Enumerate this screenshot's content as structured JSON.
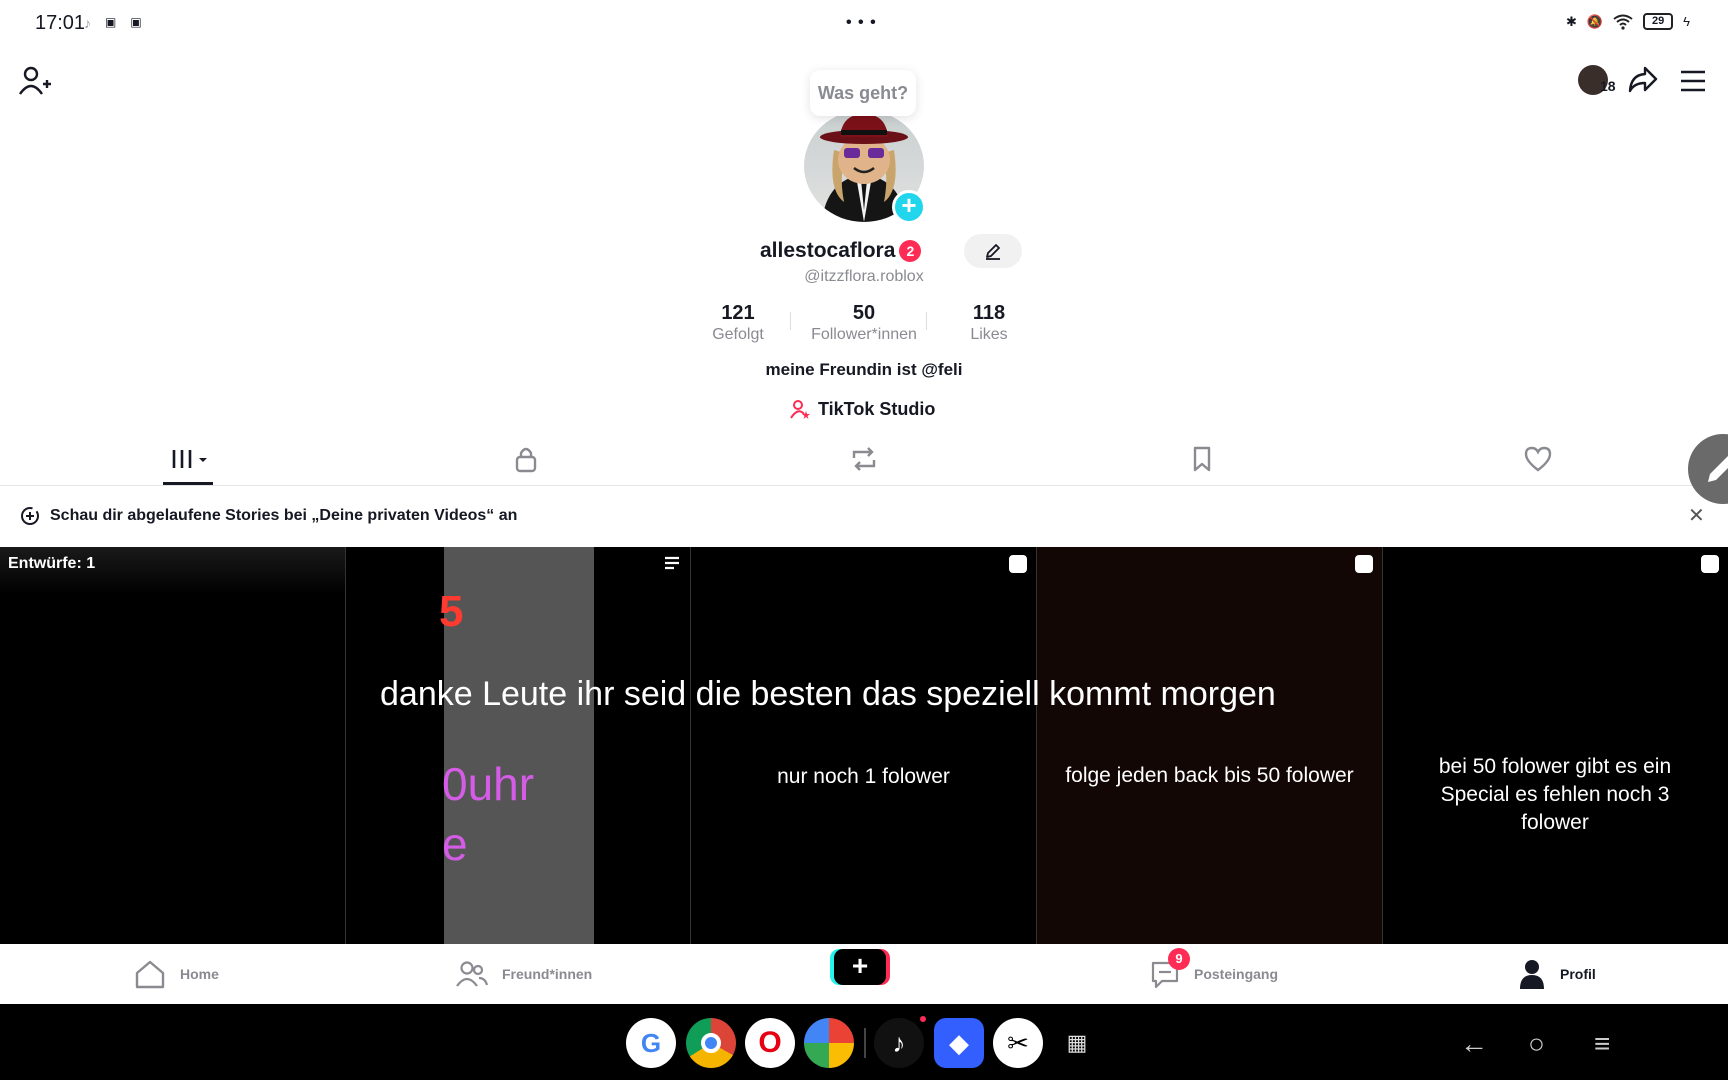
{
  "status_bar": {
    "time": "17:01",
    "battery": "29",
    "more": "• • •"
  },
  "header": {
    "story_bubble": "Was geht?",
    "notification_count": "18"
  },
  "profile": {
    "display_name": "allestocaflora",
    "name_badge": "2",
    "handle": "@itzzflora.roblox",
    "stats": [
      {
        "value": "121",
        "label": "Gefolgt"
      },
      {
        "value": "50",
        "label": "Follower*innen"
      },
      {
        "value": "118",
        "label": "Likes"
      }
    ],
    "bio": "meine Freundin ist @feli",
    "studio_link": "TikTok Studio"
  },
  "banner": {
    "text": "Schau dir abgelaufene Stories bei „Deine privaten Videos“ an"
  },
  "grid": {
    "drafts_label": "Entwürfe: 1",
    "overlay_caption": "danke Leute ihr seid die besten das speziell kommt morgen",
    "cells": [
      {
        "text": ""
      },
      {
        "text": "0uhr",
        "subtext": "e"
      },
      {
        "text": "nur noch 1 folower"
      },
      {
        "text": "folge jeden back bis 50 folower"
      },
      {
        "text": "bei 50 folower gibt es ein Special es fehlen noch 3 folower"
      }
    ]
  },
  "nav": {
    "items": [
      {
        "label": "Home"
      },
      {
        "label": "Freund*innen"
      },
      {
        "label": "Posteingang",
        "badge": "9"
      },
      {
        "label": "Profil"
      }
    ],
    "create_label": "+"
  },
  "colors": {
    "accent": "#fe2c55",
    "cyan": "#25f4ee",
    "teal": "#20d5ec"
  }
}
